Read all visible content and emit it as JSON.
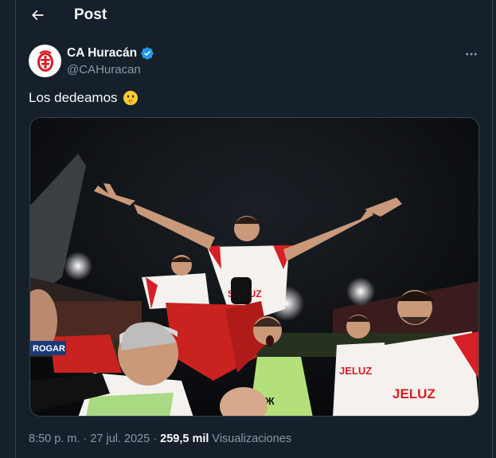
{
  "header": {
    "title": "Post"
  },
  "author": {
    "display_name": "CA Huracán",
    "handle": "@CAHuracan",
    "verified": true
  },
  "tweet": {
    "text": "Los dedeamos",
    "emoji": "shushing-face"
  },
  "media": {
    "shirt_text_center": "SIELUZ",
    "shirt_text_right1": "JELUZ",
    "shirt_text_right2": "JELUZ",
    "board_text": "ROGAR"
  },
  "meta": {
    "time": "8:50 p. m.",
    "sep1": "·",
    "date": "27 jul. 2025",
    "sep2": "·",
    "views_count": "259,5 mil",
    "views_label": "Visualizaciones"
  },
  "colors": {
    "background": "#15202b",
    "text_primary": "#f7f9f9",
    "text_secondary": "#8b98a5",
    "verified_blue": "#1d9bf0",
    "club_red": "#d61f26",
    "border": "#38444d"
  }
}
